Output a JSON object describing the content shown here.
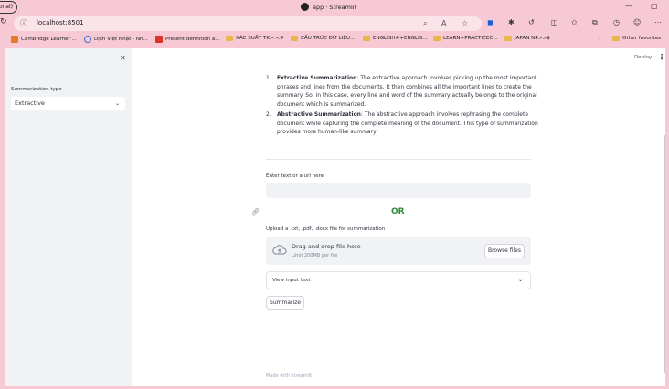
{
  "browser": {
    "profile_label": "onal)",
    "window_title": "app · Streamlit",
    "url": "localhost:8501",
    "favorites": [
      {
        "label": "Cambridge Learner'...",
        "icon": "cambridge-icon"
      },
      {
        "label": "Dịch Việt Nhật - Nh...",
        "icon": "translate-icon"
      },
      {
        "label": "Present definition a...",
        "icon": "dictionary-icon"
      },
      {
        "label": "XÁC SUẤT TK>.<#",
        "icon": "folder-icon"
      },
      {
        "label": "CẤU TRÚC DỮ LIỆU...",
        "icon": "folder-icon"
      },
      {
        "label": "ENGLISH#+ENGLIS...",
        "icon": "folder-icon"
      },
      {
        "label": "LEARN+PRACTICEC...",
        "icon": "folder-icon"
      },
      {
        "label": "JAPAN N4>>$",
        "icon": "folder-icon"
      },
      {
        "label": "Other favorites",
        "icon": "folder-icon"
      }
    ]
  },
  "sidebar": {
    "summarization_label": "Summarization type",
    "summarization_value": "Extractive"
  },
  "main": {
    "deploy_label": "Deploy",
    "methods": [
      {
        "number": "1.",
        "title": "Extractive Summarization",
        "description": ": The extractive approach involves picking up the most important phrases and lines from the documents. It then combines all the important lines to create the summary. So, in this case, every line and word of the summary actually belongs to the original document which is summarized."
      },
      {
        "number": "2.",
        "title": "Abstractive Summarization",
        "description": ": The abstractive approach involves rephrasing the complete document while capturing the complete meaning of the document. This type of summarization provides more human-like summary"
      }
    ],
    "text_input_label": "Enter text or a url here",
    "text_input_value": "",
    "or_label": "OR",
    "upload_label": "Upload a .txt, .pdf, .docx file for summarization",
    "dropzone_title": "Drag and drop file here",
    "dropzone_limit": "Limit 200MB per file",
    "browse_label": "Browse files",
    "expander_label": "View input text",
    "summarize_label": "Summarize",
    "footer_text": "Made with Streamlit"
  },
  "colors": {
    "browser_chrome": "#f7c9d4",
    "sidebar_bg": "#f0f2f6",
    "or_green": "#2e8b3a"
  }
}
